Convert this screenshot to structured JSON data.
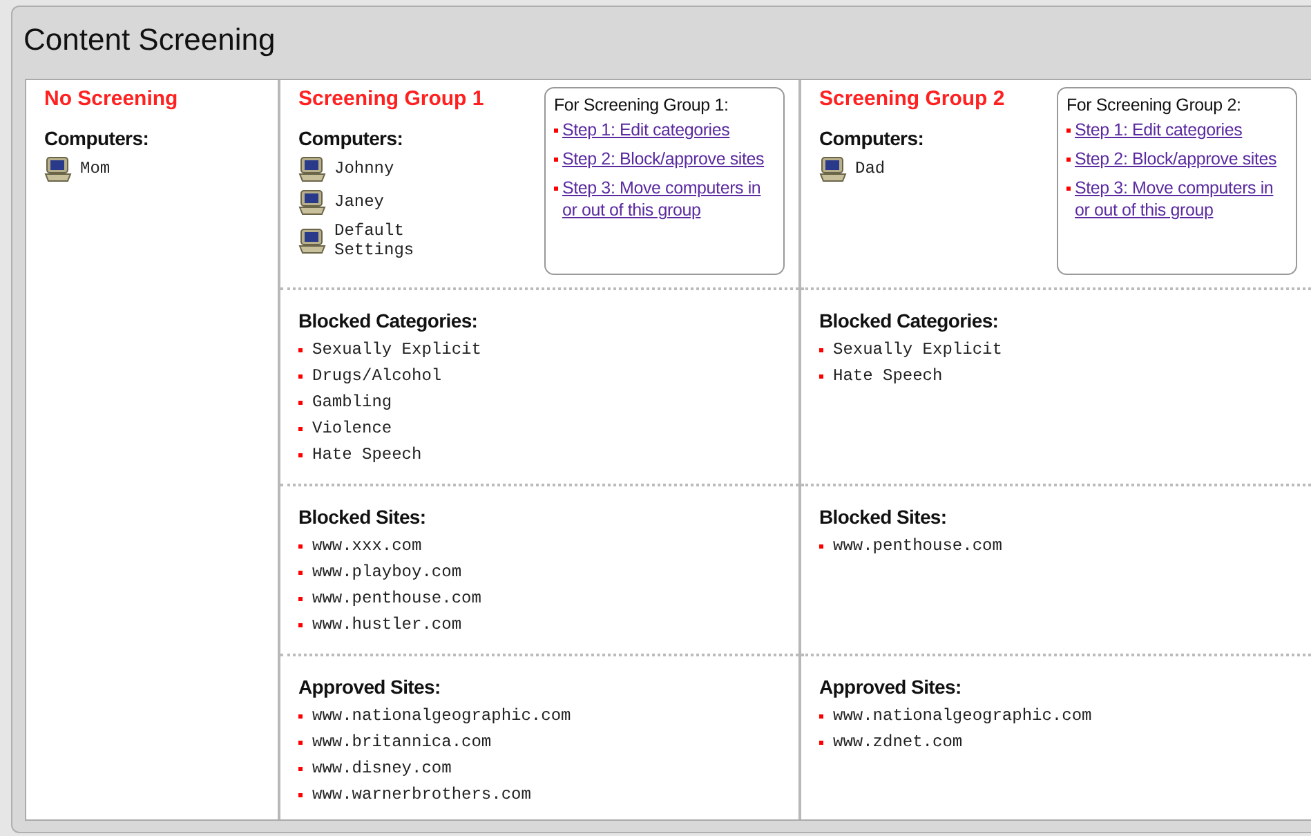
{
  "window": {
    "title": "Content Screening"
  },
  "groups": [
    {
      "kind": "none",
      "title": "No Screening",
      "computers_label": "Computers:",
      "computers": [
        "Mom"
      ]
    },
    {
      "kind": "group",
      "title": "Screening Group 1",
      "computers_label": "Computers:",
      "computers": [
        "Johnny",
        "Janey",
        "Default Settings"
      ],
      "steps": {
        "heading": "For Screening Group 1:",
        "links": [
          "Step 1: Edit categories",
          "Step 2: Block/approve sites",
          "Step 3: Move computers in or out of this group"
        ]
      },
      "sections": [
        {
          "heading": "Blocked Categories:",
          "items": [
            "Sexually Explicit",
            "Drugs/Alcohol",
            "Gambling",
            "Violence",
            "Hate Speech"
          ]
        },
        {
          "heading": "Blocked Sites:",
          "items": [
            "www.xxx.com",
            "www.playboy.com",
            "www.penthouse.com",
            "www.hustler.com"
          ]
        },
        {
          "heading": "Approved Sites:",
          "items": [
            "www.nationalgeographic.com",
            "www.britannica.com",
            "www.disney.com",
            "www.warnerbrothers.com"
          ]
        }
      ]
    },
    {
      "kind": "group",
      "title": "Screening Group 2",
      "computers_label": "Computers:",
      "computers": [
        "Dad"
      ],
      "steps": {
        "heading": "For Screening Group 2:",
        "links": [
          "Step 1: Edit categories",
          "Step 2: Block/approve sites",
          "Step 3: Move computers in or out of this group"
        ]
      },
      "sections": [
        {
          "heading": "Blocked Categories:",
          "items": [
            "Sexually Explicit",
            "Hate Speech"
          ]
        },
        {
          "heading": "Blocked Sites:",
          "items": [
            "www.penthouse.com"
          ]
        },
        {
          "heading": "Approved Sites:",
          "items": [
            "www.nationalgeographic.com",
            "www.zdnet.com"
          ]
        }
      ]
    }
  ]
}
